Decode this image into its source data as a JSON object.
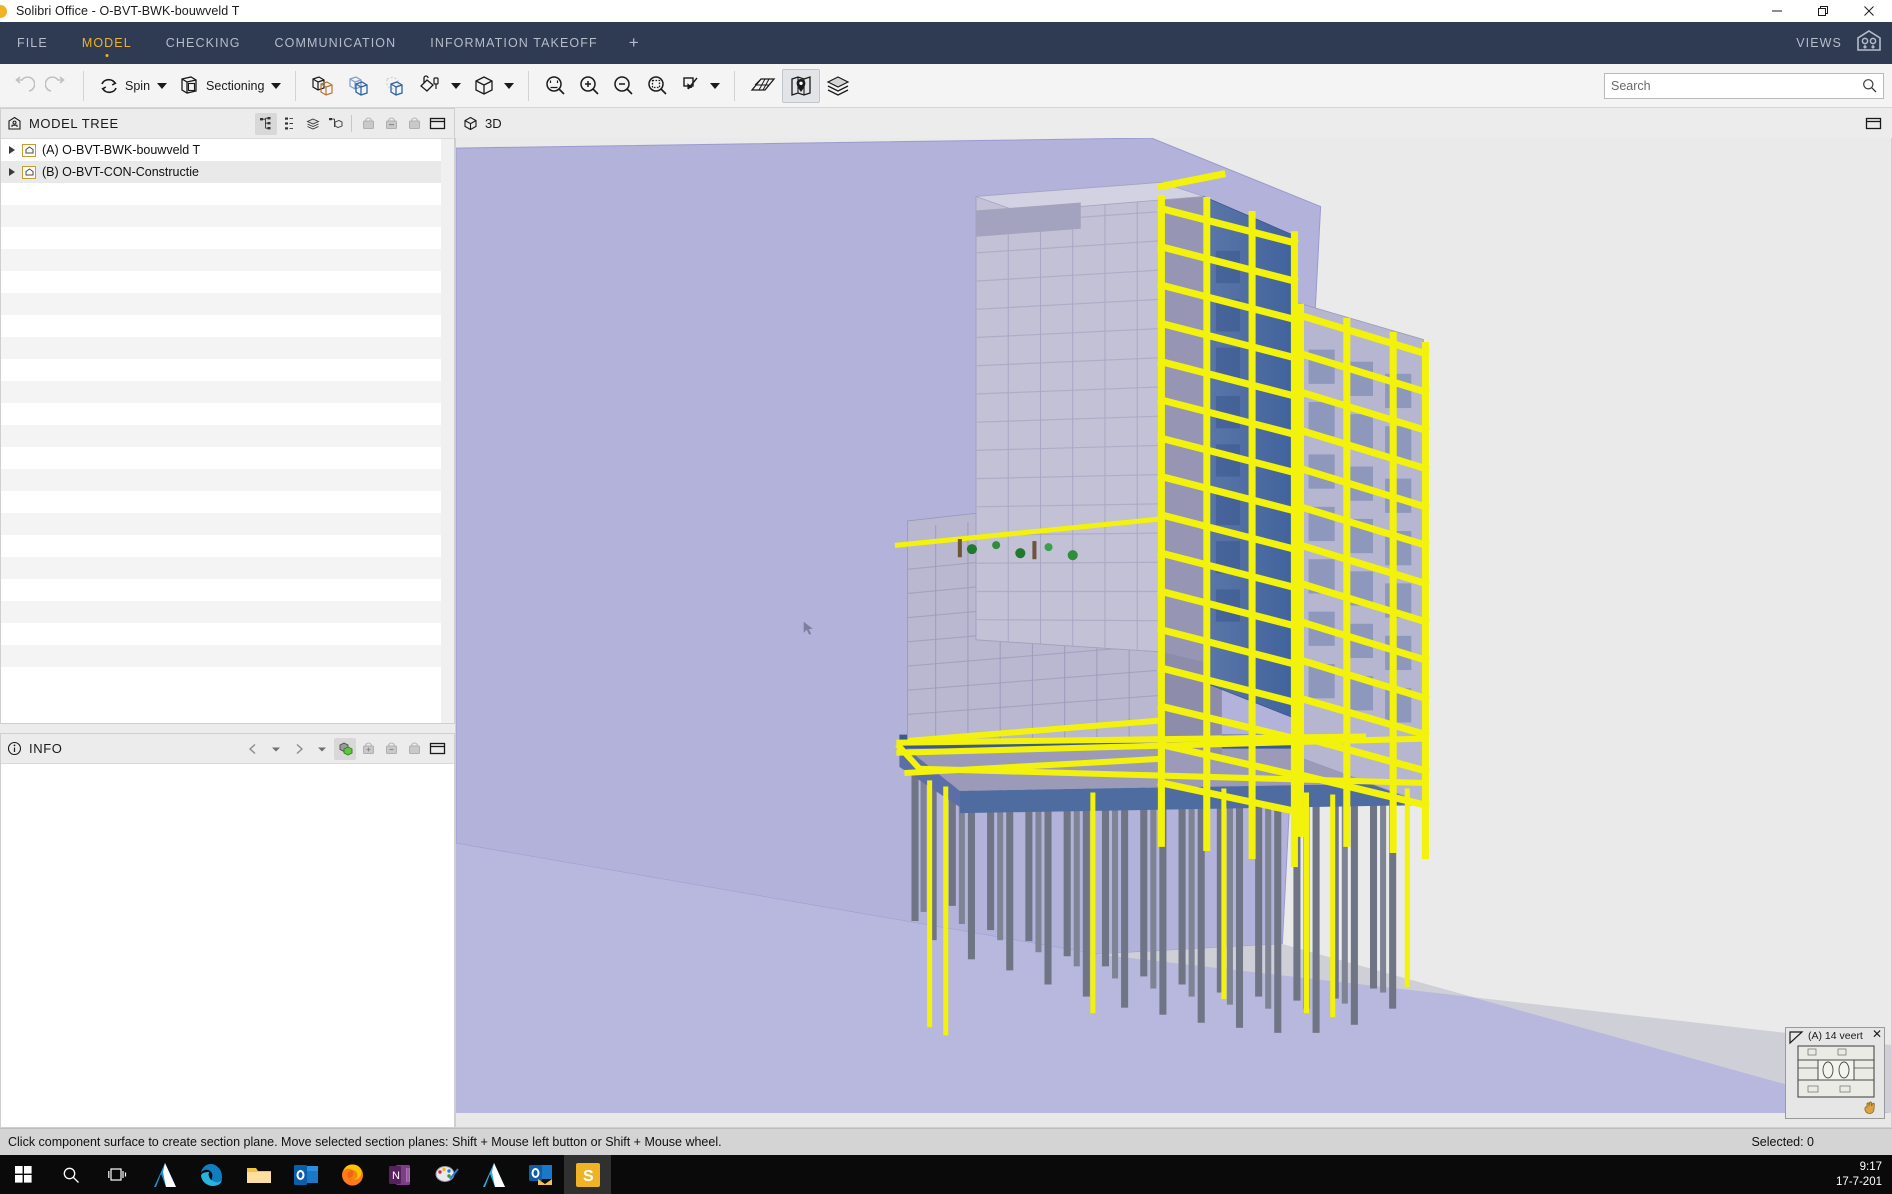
{
  "window": {
    "title": "Solibri Office - O-BVT-BWK-bouwveld T",
    "minimize_label": "Minimize",
    "restore_label": "Restore",
    "close_label": "Close"
  },
  "menubar": {
    "items": [
      {
        "label": "FILE",
        "active": false
      },
      {
        "label": "MODEL",
        "active": true
      },
      {
        "label": "CHECKING",
        "active": false
      },
      {
        "label": "COMMUNICATION",
        "active": false
      },
      {
        "label": "INFORMATION TAKEOFF",
        "active": false
      }
    ],
    "add_tab_label": "+",
    "views_label": "VIEWS",
    "views_icon": "solibri-views-icon",
    "accent_color": "#f0b323",
    "bar_color": "#2f3a53"
  },
  "toolbar": {
    "undo_label": "Undo",
    "redo_label": "Redo",
    "spin_label": "Spin",
    "sectioning_label": "Sectioning",
    "buttons": [
      {
        "name": "transparent-components-icon",
        "tooltip": "Transparent"
      },
      {
        "name": "hide-components-icon",
        "tooltip": "Hide"
      },
      {
        "name": "show-only-icon",
        "tooltip": "Show Only"
      },
      {
        "name": "paint-components-icon",
        "tooltip": "Paint"
      },
      {
        "name": "view-cube-icon",
        "tooltip": "Views"
      },
      {
        "name": "zoom-fit-icon",
        "tooltip": "Fit to View"
      },
      {
        "name": "zoom-in-icon",
        "tooltip": "Zoom In"
      },
      {
        "name": "zoom-out-icon",
        "tooltip": "Zoom Out"
      },
      {
        "name": "zoom-area-icon",
        "tooltip": "Zoom Area"
      },
      {
        "name": "pick-component-icon",
        "tooltip": "Selection Mode"
      },
      {
        "name": "grid-icon",
        "tooltip": "Grid"
      },
      {
        "name": "location-marker-icon",
        "tooltip": "Markup / Location"
      },
      {
        "name": "layers-icon",
        "tooltip": "Layers"
      }
    ],
    "search_placeholder": "Search",
    "search_value": "",
    "search_icon": "search-icon"
  },
  "model_tree": {
    "panel_icon": "model-tree-icon",
    "title": "MODEL TREE",
    "tools": [
      {
        "name": "hierarchy-view-icon",
        "selected": true
      },
      {
        "name": "list-view-icon",
        "selected": false
      },
      {
        "name": "layers-view-icon",
        "selected": false
      },
      {
        "name": "component-view-icon",
        "selected": false
      },
      {
        "name": "basket-add-icon",
        "selected": false,
        "disabled": true
      },
      {
        "name": "basket-remove-icon",
        "selected": false,
        "disabled": true
      },
      {
        "name": "basket-icon",
        "selected": false,
        "disabled": true
      },
      {
        "name": "detach-panel-icon",
        "selected": false
      }
    ],
    "rows": [
      {
        "label": "(A) O-BVT-BWK-bouwveld T",
        "icon": "model-file-icon",
        "expandable": true
      },
      {
        "label": "(B) O-BVT-CON-Constructie",
        "icon": "model-file-icon",
        "expandable": true
      }
    ],
    "empty_row_count": 23
  },
  "info": {
    "panel_icon": "info-icon",
    "title": "INFO",
    "tools": [
      {
        "name": "previous-icon",
        "selected": false
      },
      {
        "name": "previous-dropdown-icon",
        "selected": false
      },
      {
        "name": "next-icon",
        "selected": false
      },
      {
        "name": "next-dropdown-icon",
        "selected": false
      },
      {
        "name": "component-info-icon",
        "selected": true
      },
      {
        "name": "basket-add-icon",
        "selected": false,
        "disabled": true
      },
      {
        "name": "basket-remove-icon",
        "selected": false,
        "disabled": true
      },
      {
        "name": "basket-icon",
        "selected": false,
        "disabled": true
      },
      {
        "name": "detach-panel-icon",
        "selected": false
      }
    ],
    "content": ""
  },
  "view": {
    "icon": "cube-icon",
    "title": "3D",
    "detach_icon": "detach-panel-icon",
    "background_color": "#b3b2da",
    "section_plane_color": "#9a99c9",
    "highlight_color": "#f2f20d",
    "structure_color": "#8f8fa8",
    "slab_color": "#4e6ca0"
  },
  "minimap": {
    "label": "(A) 14 veert",
    "close_label": "✕",
    "corner_icon": "view-corner-icon"
  },
  "statusbar": {
    "hint": "Click component surface to create section plane. Move selected section planes: Shift + Mouse left button or Shift + Mouse wheel.",
    "selected_text": "Selected: 0"
  },
  "taskbar": {
    "items": [
      {
        "name": "start-button",
        "label": "Start",
        "color": "#ffffff"
      },
      {
        "name": "search-icon",
        "label": "Search",
        "color": "#ffffff"
      },
      {
        "name": "task-view-icon",
        "label": "Task View",
        "color": "#ffffff"
      },
      {
        "name": "revit-icon",
        "label": "Revit",
        "color": "#1e7ac4"
      },
      {
        "name": "edge-icon",
        "label": "Microsoft Edge",
        "color": "#1b8ec2"
      },
      {
        "name": "file-explorer-icon",
        "label": "File Explorer",
        "color": "#f2c14e"
      },
      {
        "name": "outlook-icon",
        "label": "Outlook",
        "color": "#0f6cbd"
      },
      {
        "name": "firefox-icon",
        "label": "Firefox",
        "color": "#e86c1a"
      },
      {
        "name": "onenote-icon",
        "label": "OneNote",
        "color": "#80397b"
      },
      {
        "name": "paint-icon",
        "label": "Paint",
        "color": "#b9b9c8"
      },
      {
        "name": "revit-2-icon",
        "label": "Revit",
        "color": "#1e9ad6"
      },
      {
        "name": "outlook-mail-icon",
        "label": "Outlook Mail",
        "color": "#0f6cbd"
      },
      {
        "name": "solibri-icon",
        "label": "Solibri Office",
        "color": "#f0b323",
        "active": true
      }
    ],
    "clock_time": "9:17",
    "clock_date": "17-7-201"
  }
}
